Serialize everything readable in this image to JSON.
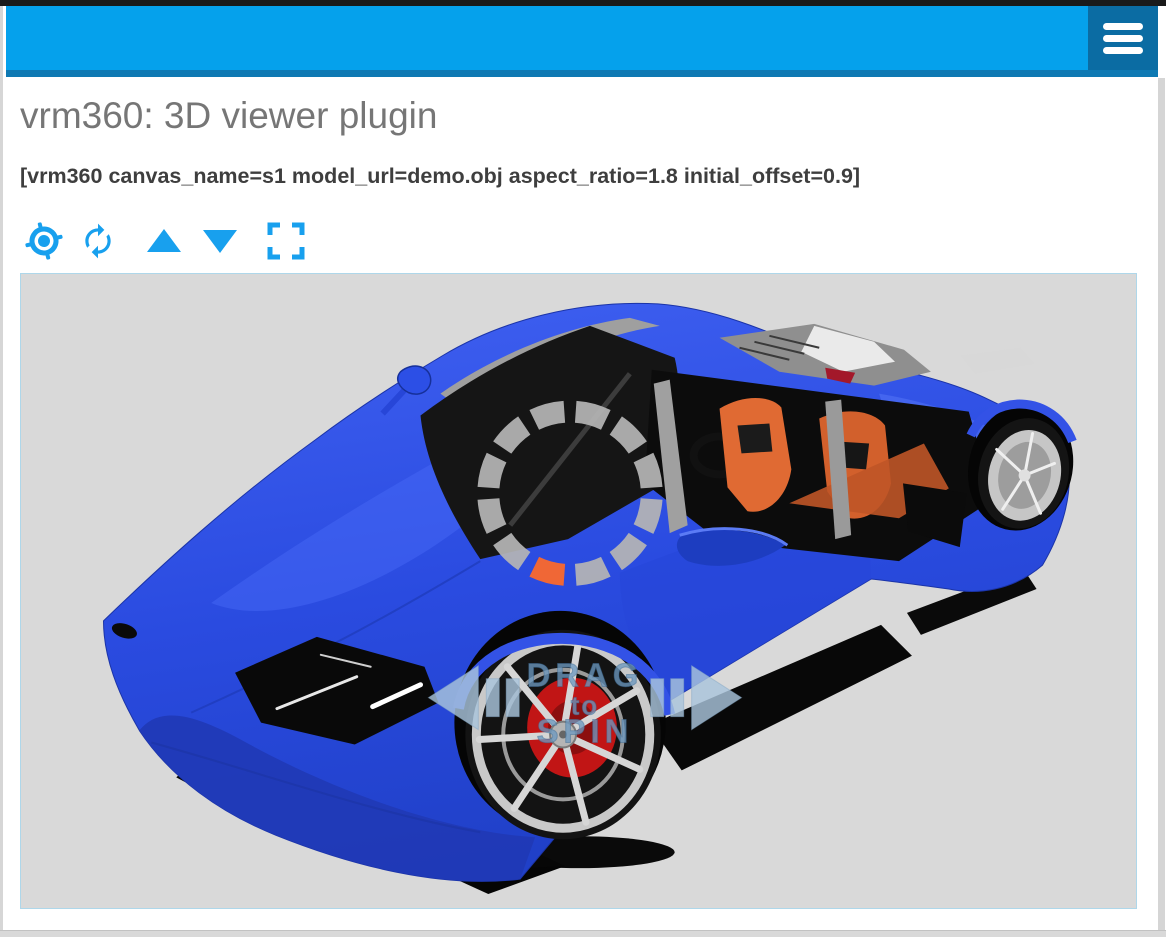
{
  "header": {
    "background_color": "#05a1ec",
    "bottom_border_color": "#0e79b3",
    "menu_button_color": "#0b6ca3",
    "menu_icon": "hamburger-icon"
  },
  "page": {
    "title": "vrm360: 3D viewer plugin",
    "shortcode": "[vrm360 canvas_name=s1 model_url=demo.obj aspect_ratio=1.8 initial_offset=0.9]"
  },
  "toolbar": {
    "icon_color": "#18a0ee",
    "buttons": [
      {
        "name": "center-model",
        "icon": "target-icon"
      },
      {
        "name": "auto-rotate",
        "icon": "rotate-icon"
      },
      {
        "name": "move-up",
        "icon": "triangle-up-icon"
      },
      {
        "name": "move-down",
        "icon": "triangle-down-icon"
      },
      {
        "name": "fullscreen",
        "icon": "fullscreen-icon"
      }
    ]
  },
  "viewer": {
    "canvas_name": "s1",
    "canvas_background": "#d9d9d9",
    "canvas_border_color": "#aed7ea",
    "model": {
      "file": "demo.obj",
      "body_color": "#2b4fe4",
      "interior_color": "#df6a33",
      "description": "blue sports car 3D render, front three-quarter top view"
    },
    "spinner": {
      "segments": 12,
      "segment_color": "#b5b5b5",
      "active_segment_color": "#ff6a2a"
    },
    "drag_hint": {
      "line1": "DRAG",
      "line2": "to",
      "line3": "SPIN",
      "text_color": "#6d98bf",
      "arrow_color": "#a9c4dc"
    }
  }
}
